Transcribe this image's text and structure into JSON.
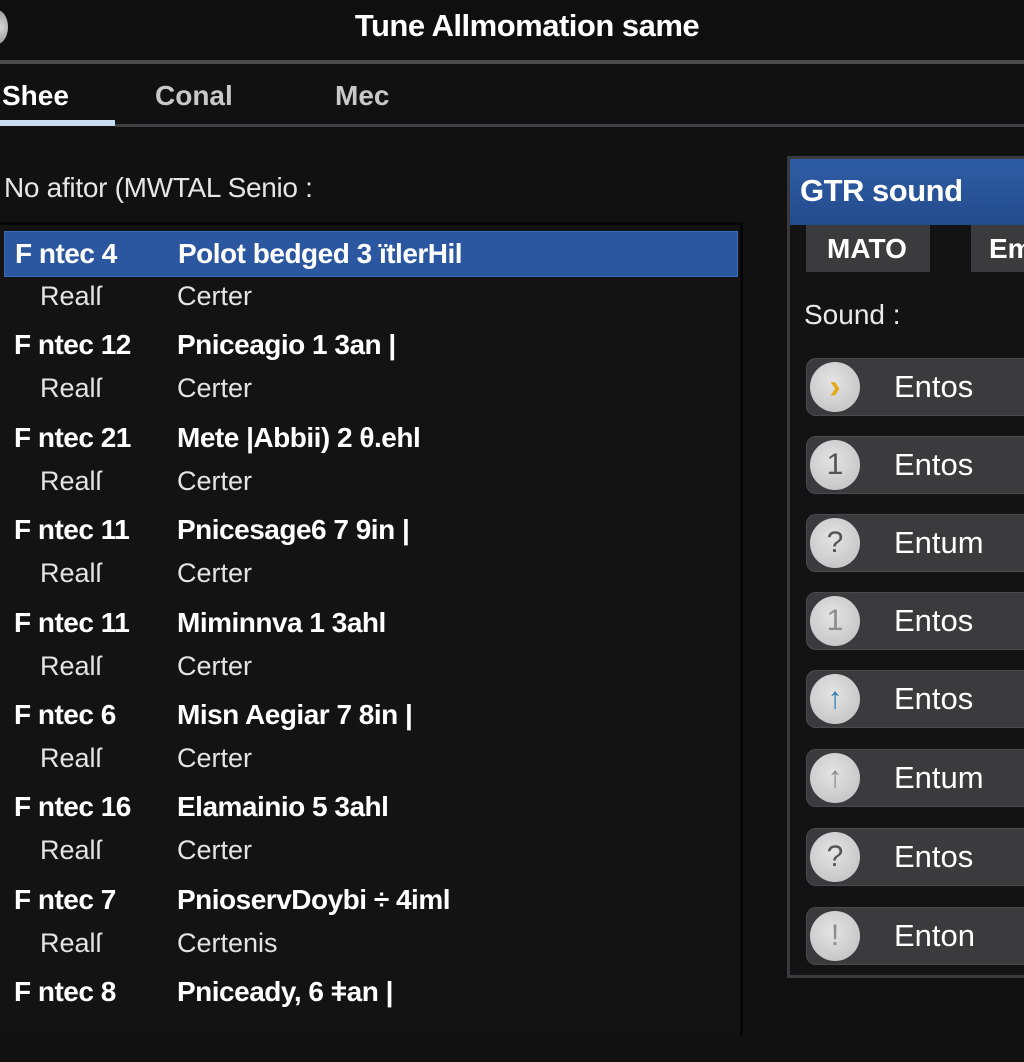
{
  "window": {
    "title": "Tune Allmomation same"
  },
  "tabs": [
    {
      "label": "Shee",
      "active": true
    },
    {
      "label": "Conal",
      "active": false
    },
    {
      "label": "Mec",
      "active": false
    }
  ],
  "list": {
    "section_label": "No afitor (MWTAL Senio :",
    "rows": [
      {
        "id": "F ntec 4",
        "name": "Polot bedged 3 ïtlerHil",
        "sub1": "Realſ",
        "sub2": "Certer",
        "selected": true
      },
      {
        "id": "F ntec 12",
        "name": "Pniceagio 1 3an |",
        "sub1": "Realſ",
        "sub2": "Certer",
        "selected": false
      },
      {
        "id": "F ntec 21",
        "name": "Mete |Abbii) 2 θ.ehl",
        "sub1": "Realſ",
        "sub2": "Certer",
        "selected": false
      },
      {
        "id": "F ntec 11",
        "name": "Pnicesage6 7 9in |",
        "sub1": "Realſ",
        "sub2": "Certer",
        "selected": false
      },
      {
        "id": "F ntec 11",
        "name": "Miminnva 1 3ahl",
        "sub1": "Realſ",
        "sub2": "Certer",
        "selected": false
      },
      {
        "id": "F ntec 6",
        "name": "Misn Aegiar 7 8in |",
        "sub1": "Realſ",
        "sub2": "Certer",
        "selected": false
      },
      {
        "id": "F ntec 16",
        "name": "Elamainio 5 3ahl",
        "sub1": "Realſ",
        "sub2": "Certer",
        "selected": false
      },
      {
        "id": "F ntec 7",
        "name": "PnioservDoybi ÷ 4iml",
        "sub1": "Realſ",
        "sub2": "Certenis",
        "selected": false
      },
      {
        "id": "F ntec 8",
        "name": "Pniceady, 6 ǂan |",
        "sub1": "",
        "sub2": "",
        "selected": false
      }
    ]
  },
  "side_panel": {
    "title": "GTR sound",
    "tabs": [
      {
        "label": "MATO"
      },
      {
        "label": "Em"
      }
    ],
    "sound_label": "Sound :",
    "buttons": [
      {
        "icon": "chevron-right-icon",
        "glyph": "›",
        "label": "Entos"
      },
      {
        "icon": "info-one-icon",
        "glyph": "1",
        "label": "Entos"
      },
      {
        "icon": "question-icon",
        "glyph": "?",
        "label": "Entum"
      },
      {
        "icon": "info-one-icon",
        "glyph": "1",
        "label": "Entos"
      },
      {
        "icon": "arrow-up-icon",
        "glyph": "↑",
        "label": "Entos"
      },
      {
        "icon": "arrow-up-icon",
        "glyph": "↑",
        "label": "Entum"
      },
      {
        "icon": "question-icon",
        "glyph": "?",
        "label": "Entos"
      },
      {
        "icon": "exclamation-icon",
        "glyph": "!",
        "label": "Enton"
      }
    ]
  },
  "colors": {
    "accent_blue": "#2a57a0",
    "header_blue": "#2e5da5",
    "tab_underline": "#c9ddf0",
    "chevron_yellow": "#e2a91b"
  }
}
